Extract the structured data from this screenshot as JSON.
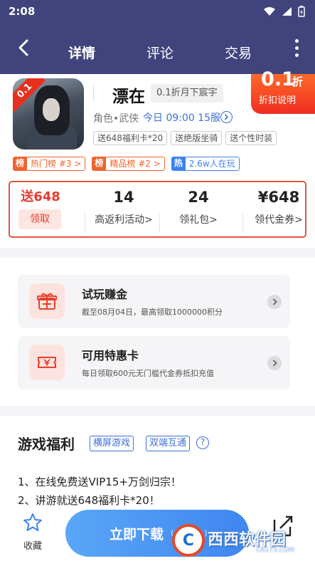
{
  "status_bar": {
    "time": "2:08"
  },
  "nav": {
    "tabs": [
      {
        "label": "详情",
        "active": true
      },
      {
        "label": "评论",
        "active": false
      },
      {
        "label": "交易",
        "active": false
      }
    ]
  },
  "game": {
    "ribbon": "0.1",
    "name": "漂在",
    "subtitle": "0.1折月下宸宇",
    "discount": {
      "value": "0.1",
      "unit": "折",
      "explain": "折扣说明"
    },
    "category": "角色•武侠",
    "server": "今日 09:00 15服",
    "chips": [
      "送648福利卡*20",
      "送绝版坐骑",
      "送个性时装"
    ],
    "ranks": [
      {
        "label": "榜",
        "value": "热门榜 #3"
      },
      {
        "label": "榜",
        "value": "精品榜 #2"
      },
      {
        "label": "热",
        "value": "2.6w人在玩"
      }
    ]
  },
  "stats": {
    "gift": {
      "value": "送648",
      "button": "领取"
    },
    "rebate": {
      "value": "14",
      "label": "高返利活动"
    },
    "package": {
      "value": "24",
      "label": "领礼包"
    },
    "voucher": {
      "value": "¥648",
      "label": "领代金券"
    }
  },
  "tasks": [
    {
      "title": "试玩赚金",
      "desc": "截至08月04日，最高领取1000000积分",
      "icon": "gift-box-icon"
    },
    {
      "title": "可用特惠卡",
      "desc": "每日领取600元无门槛代金券抵扣充值",
      "icon": "coupon-ticket-icon"
    }
  ],
  "welfare": {
    "title": "游戏福利",
    "tags": [
      "横屏游戏",
      "双端互通"
    ],
    "help": "?",
    "lines": [
      "1、在线免费送VIP15+万剑归宗！",
      "2、讲游就送648福利卡*20！"
    ]
  },
  "bottom": {
    "favorite": "收藏",
    "download": "立即下载",
    "download_size": "(4…53…)"
  },
  "watermark": {
    "circle": "C",
    "text": "西西软件园",
    "url": "CR173.COM"
  },
  "colors": {
    "header_bg": "#41447c",
    "accent_red": "#e83a2c",
    "accent_blue": "#3e6fd8",
    "download_blue": "#4a93f4"
  }
}
